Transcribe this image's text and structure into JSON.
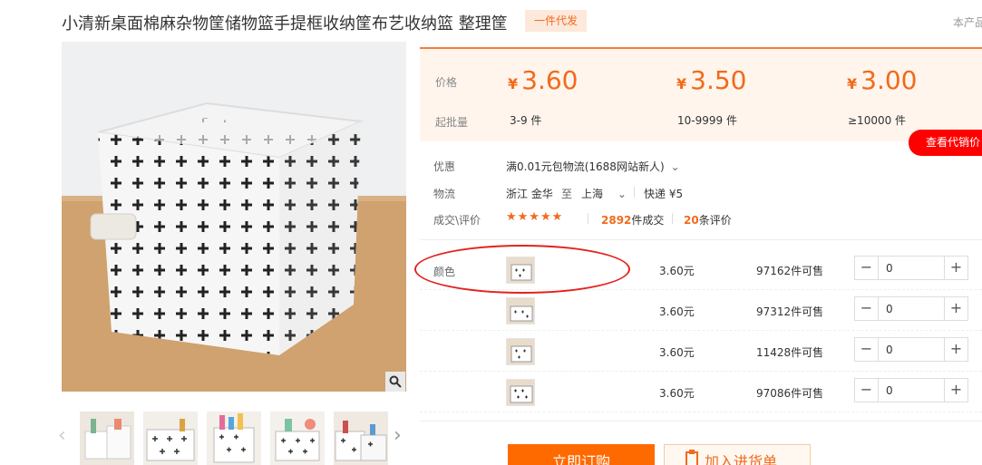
{
  "product": {
    "title": "小清新桌面棉麻杂物筐储物篮手提框收纳筐布艺收纳篮 整理筐",
    "badge": "一件代发",
    "right_note": "本产品"
  },
  "price_panel": {
    "price_label": "价格",
    "moq_label": "起批量",
    "currency": "¥",
    "tiers": [
      {
        "price": "3.60",
        "range": "3-9 件"
      },
      {
        "price": "3.50",
        "range": "10-9999 件"
      },
      {
        "price": "3.00",
        "range": "≥10000 件"
      }
    ],
    "agent_button": "查看代销价"
  },
  "info": {
    "promo_label": "优惠",
    "promo_text": "满0.01元包物流(1688网站新人)",
    "logistics_label": "物流",
    "from": "浙江 金华",
    "to_word": "至",
    "to": "上海",
    "shipping": "快递 ¥5",
    "deals_label": "成交\\评价",
    "stars": "★★★★★",
    "deals_count": "2892",
    "deals_unit": "件成交",
    "reviews_count": "20",
    "reviews_unit": "条评价"
  },
  "sku": {
    "color_label": "颜色",
    "rows": [
      {
        "price": "3.60元",
        "stock": "97162件可售",
        "qty": "0"
      },
      {
        "price": "3.60元",
        "stock": "97312件可售",
        "qty": "0"
      },
      {
        "price": "3.60元",
        "stock": "11428件可售",
        "qty": "0"
      },
      {
        "price": "3.60元",
        "stock": "97086件可售",
        "qty": "0"
      }
    ],
    "minus": "−",
    "plus": "+"
  },
  "actions": {
    "buy": "立即订购",
    "cart": "加入进货单"
  },
  "icons": {
    "zoom": "magnifier-icon",
    "prev": "chevron-left-icon",
    "next": "chevron-right-icon",
    "cart": "cart-list-icon"
  },
  "colors": {
    "accent": "#f26a1b",
    "buy": "#ff6a00",
    "agent": "#ff0000",
    "panel": "#fff5ec",
    "annotation": "#e2241f"
  }
}
